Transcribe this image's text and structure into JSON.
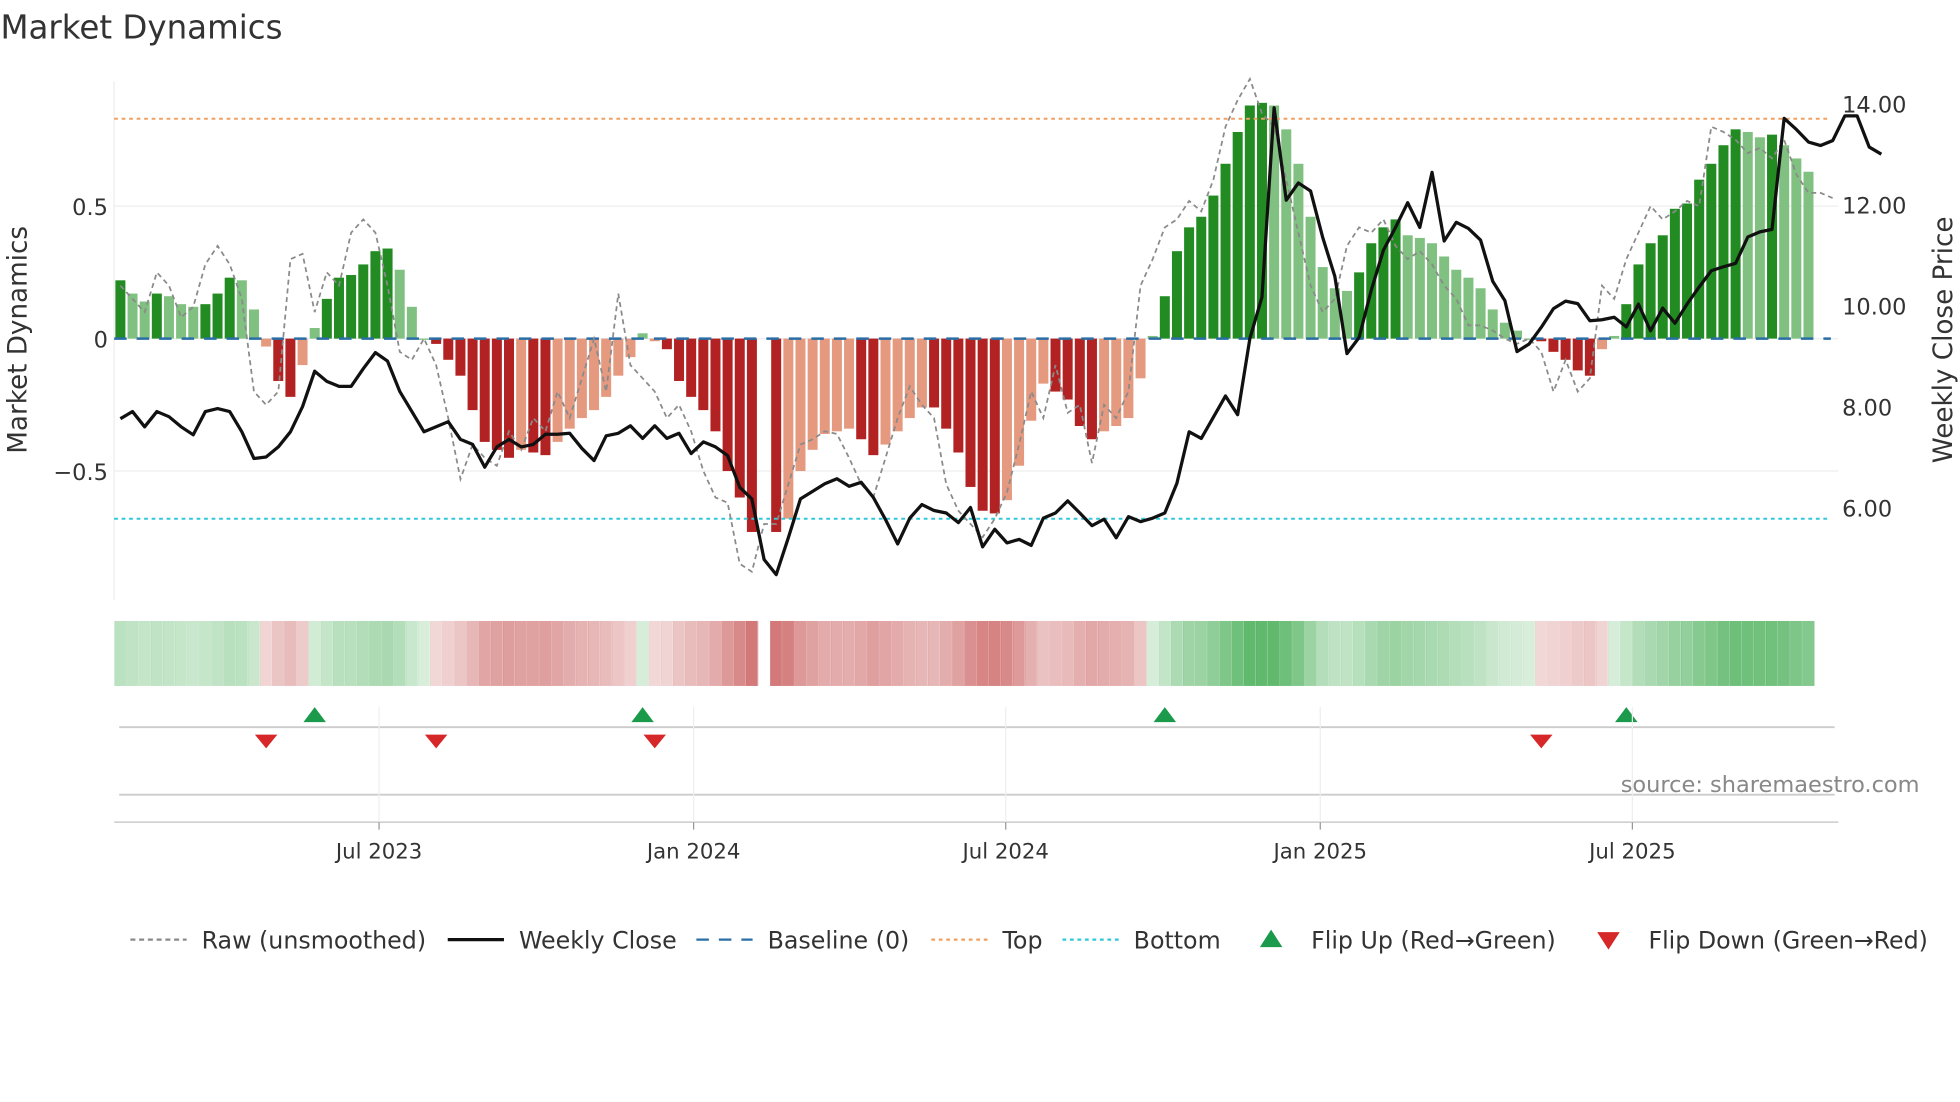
{
  "chart_data": {
    "type": "bar",
    "title": "Market Dynamics",
    "ylabel": "Market Dynamics",
    "y2label": "Weekly Close Price",
    "ylim": [
      -0.98,
      1.0
    ],
    "y2lim": [
      4.0,
      14.5
    ],
    "yticks": [
      {
        "v": 0.5,
        "label": "0.5"
      },
      {
        "v": 0,
        "label": "0"
      },
      {
        "v": -0.5,
        "label": "−0.5"
      }
    ],
    "y2ticks": [
      {
        "v": 14,
        "label": "14.00"
      },
      {
        "v": 12,
        "label": "12.00"
      },
      {
        "v": 10,
        "label": "10.00"
      },
      {
        "v": 8,
        "label": "8.00"
      },
      {
        "v": 6,
        "label": "6.00"
      }
    ],
    "xticks": [
      {
        "week": 21.3,
        "label": "Jul 2023"
      },
      {
        "week": 47.2,
        "label": "Jan 2024"
      },
      {
        "week": 72.9,
        "label": "Jul 2024"
      },
      {
        "week": 98.8,
        "label": "Jan 2025"
      },
      {
        "week": 124.5,
        "label": "Jul 2025"
      }
    ],
    "top_level": 0.83,
    "bottom_level": -0.68,
    "momentum": [
      0.22,
      0.17,
      0.14,
      0.17,
      0.16,
      0.13,
      0.12,
      0.13,
      0.17,
      0.23,
      0.22,
      0.11,
      -0.03,
      -0.16,
      -0.22,
      -0.1,
      0.04,
      0.15,
      0.23,
      0.24,
      0.28,
      0.33,
      0.34,
      0.26,
      0.12,
      0.0,
      -0.02,
      -0.08,
      -0.14,
      -0.27,
      -0.39,
      -0.42,
      -0.45,
      -0.42,
      -0.43,
      -0.44,
      -0.39,
      -0.34,
      -0.3,
      -0.27,
      -0.22,
      -0.14,
      -0.07,
      0.02,
      -0.01,
      -0.04,
      -0.16,
      -0.22,
      -0.27,
      -0.35,
      -0.5,
      -0.6,
      -0.73,
      null,
      -0.73,
      -0.68,
      -0.5,
      -0.42,
      -0.36,
      -0.35,
      -0.34,
      -0.38,
      -0.44,
      -0.4,
      -0.35,
      -0.3,
      -0.26,
      -0.26,
      -0.34,
      -0.43,
      -0.56,
      -0.65,
      -0.66,
      -0.61,
      -0.48,
      -0.31,
      -0.17,
      -0.2,
      -0.23,
      -0.33,
      -0.38,
      -0.35,
      -0.33,
      -0.3,
      -0.15,
      0.01,
      0.16,
      0.33,
      0.42,
      0.46,
      0.54,
      0.66,
      0.78,
      0.88,
      0.89,
      0.88,
      0.79,
      0.66,
      0.46,
      0.27,
      0.19,
      0.18,
      0.25,
      0.36,
      0.42,
      0.45,
      0.39,
      0.38,
      0.36,
      0.31,
      0.26,
      0.23,
      0.19,
      0.11,
      0.06,
      0.03,
      0.0,
      -0.01,
      -0.05,
      -0.08,
      -0.12,
      -0.14,
      -0.04,
      0.01,
      0.13,
      0.28,
      0.36,
      0.39,
      0.49,
      0.51,
      0.6,
      0.66,
      0.73,
      0.79,
      0.78,
      0.76,
      0.77,
      0.73,
      0.68,
      0.63
    ],
    "raw": [
      0.2,
      0.15,
      0.1,
      0.25,
      0.2,
      0.08,
      0.12,
      0.28,
      0.35,
      0.28,
      0.15,
      -0.2,
      -0.25,
      -0.2,
      0.3,
      0.32,
      0.1,
      0.25,
      0.2,
      0.4,
      0.45,
      0.4,
      0.2,
      -0.05,
      -0.08,
      0.0,
      -0.1,
      -0.3,
      -0.53,
      -0.4,
      -0.45,
      -0.48,
      -0.35,
      -0.42,
      -0.3,
      -0.35,
      -0.2,
      -0.3,
      -0.15,
      0.0,
      -0.2,
      0.17,
      -0.1,
      -0.15,
      -0.2,
      -0.3,
      -0.25,
      -0.35,
      -0.5,
      -0.6,
      -0.62,
      -0.85,
      -0.88,
      -0.7,
      -0.7,
      -0.55,
      -0.4,
      -0.38,
      -0.35,
      -0.36,
      -0.45,
      -0.55,
      -0.6,
      -0.45,
      -0.3,
      -0.18,
      -0.25,
      -0.3,
      -0.55,
      -0.65,
      -0.7,
      -0.75,
      -0.68,
      -0.58,
      -0.4,
      -0.2,
      -0.3,
      -0.1,
      -0.28,
      -0.25,
      -0.47,
      -0.25,
      -0.3,
      -0.2,
      0.2,
      0.3,
      0.42,
      0.45,
      0.52,
      0.48,
      0.6,
      0.8,
      0.9,
      0.98,
      0.85,
      0.8,
      0.6,
      0.4,
      0.2,
      0.1,
      0.15,
      0.35,
      0.42,
      0.4,
      0.45,
      0.35,
      0.3,
      0.33,
      0.28,
      0.2,
      0.15,
      0.05,
      0.05,
      0.03,
      0.0,
      -0.02,
      0.0,
      -0.05,
      -0.2,
      -0.08,
      -0.2,
      -0.15,
      0.2,
      0.15,
      0.3,
      0.4,
      0.5,
      0.45,
      0.48,
      0.52,
      0.5,
      0.8,
      0.78,
      0.75,
      0.7,
      0.72,
      0.68,
      0.75,
      0.62,
      0.55,
      0.55,
      0.53
    ],
    "close": [
      7.76,
      7.9,
      7.6,
      7.9,
      7.8,
      7.6,
      7.44,
      7.9,
      7.96,
      7.9,
      7.5,
      6.97,
      7.0,
      7.2,
      7.5,
      8.0,
      8.7,
      8.5,
      8.4,
      8.4,
      8.75,
      9.07,
      8.9,
      8.3,
      7.9,
      7.5,
      7.6,
      7.7,
      7.35,
      7.25,
      6.8,
      7.2,
      7.35,
      7.2,
      7.25,
      7.45,
      7.45,
      7.47,
      7.17,
      6.93,
      7.42,
      7.47,
      7.62,
      7.37,
      7.62,
      7.37,
      7.47,
      7.07,
      7.3,
      7.2,
      7.03,
      6.4,
      6.17,
      4.97,
      4.67,
      5.4,
      6.17,
      6.32,
      6.47,
      6.57,
      6.42,
      6.5,
      6.2,
      5.76,
      5.28,
      5.79,
      6.06,
      5.94,
      5.89,
      5.7,
      6.0,
      5.22,
      5.57,
      5.3,
      5.37,
      5.25,
      5.79,
      5.89,
      6.13,
      5.89,
      5.64,
      5.77,
      5.4,
      5.82,
      5.72,
      5.79,
      5.89,
      6.48,
      7.5,
      7.37,
      7.79,
      8.21,
      7.84,
      9.35,
      10.17,
      13.92,
      12.09,
      12.43,
      12.27,
      11.35,
      10.58,
      9.05,
      9.37,
      10.31,
      11.1,
      11.55,
      12.04,
      11.55,
      12.64,
      11.28,
      11.65,
      11.53,
      11.3,
      10.48,
      10.1,
      9.09,
      9.24,
      9.57,
      9.94,
      10.09,
      10.04,
      9.7,
      9.72,
      9.77,
      9.58,
      10.03,
      9.5,
      9.95,
      9.65,
      10.03,
      10.37,
      10.69,
      10.77,
      10.84,
      11.36,
      11.46,
      11.51,
      13.71,
      13.49,
      13.24,
      13.17,
      13.27,
      13.76,
      13.76,
      13.14,
      13.0
    ],
    "flips_up": [
      16,
      43,
      86,
      124
    ],
    "flips_down": [
      12,
      26,
      44,
      117
    ],
    "series": [
      {
        "name": "Raw (unsmoothed)",
        "color": "#8a8a8a"
      },
      {
        "name": "Weekly Close",
        "color": "#111111"
      },
      {
        "name": "Baseline (0)",
        "color": "#2a6ea6"
      },
      {
        "name": "Top",
        "color": "#f0a060"
      },
      {
        "name": "Bottom",
        "color": "#30c8d8"
      },
      {
        "name": "Flip Up (Red→Green)",
        "color": "#1a9a4a"
      },
      {
        "name": "Flip Down (Green→Red)",
        "color": "#d62828"
      }
    ],
    "colors": {
      "green_dark": "#228b22",
      "green_light": "#80c080",
      "red_dark": "#b22222",
      "red_light": "#e59a80"
    },
    "source": "source: sharemaestro.com"
  }
}
